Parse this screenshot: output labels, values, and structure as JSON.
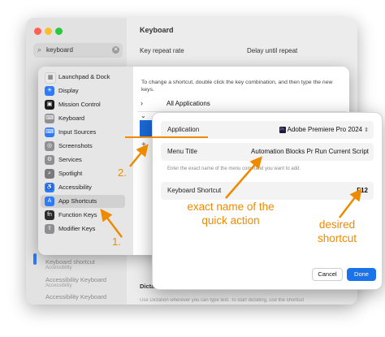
{
  "background_window": {
    "search_text": "keyboard",
    "title": "Keyboard",
    "key_repeat_label": "Key repeat rate",
    "delay_label": "Delay until repeat",
    "sidebar_results": [
      {
        "title": "Keyboard shortcut",
        "sub": "Accessibility"
      },
      {
        "title": "Accessibility Keyboard",
        "sub": "Accessibility"
      },
      {
        "title": "Accessibility Keyboard",
        "sub": ""
      }
    ],
    "dictation_label": "Dicta",
    "dictation_desc": "Use Dictation wherever you can type text. To start dictating, use the shortcut"
  },
  "sheet": {
    "sidebar": [
      {
        "label": "Launchpad & Dock",
        "icon": "launchpad-icon",
        "color": "#e9e9e9",
        "glyph": "▦"
      },
      {
        "label": "Display",
        "icon": "display-icon",
        "color": "#2f7bf5",
        "glyph": "☀"
      },
      {
        "label": "Mission Control",
        "icon": "mission-control-icon",
        "color": "#1c1c1c",
        "glyph": "▣"
      },
      {
        "label": "Keyboard",
        "icon": "keyboard-icon",
        "color": "#8e8e93",
        "glyph": "⌨"
      },
      {
        "label": "Input Sources",
        "icon": "input-sources-icon",
        "color": "#2f7bf5",
        "glyph": "⌨"
      },
      {
        "label": "Screenshots",
        "icon": "screenshots-icon",
        "color": "#8e8e93",
        "glyph": "◎"
      },
      {
        "label": "Services",
        "icon": "services-icon",
        "color": "#8e8e93",
        "glyph": "⚙"
      },
      {
        "label": "Spotlight",
        "icon": "spotlight-icon",
        "color": "#7a7a7e",
        "glyph": "⌕"
      },
      {
        "label": "Accessibility",
        "icon": "accessibility-icon",
        "color": "#2f7bf5",
        "glyph": "♿"
      },
      {
        "label": "App Shortcuts",
        "icon": "app-shortcuts-icon",
        "color": "#2f7bf5",
        "glyph": "A"
      },
      {
        "label": "Function Keys",
        "icon": "function-keys-icon",
        "color": "#2b2b2b",
        "glyph": "fn"
      },
      {
        "label": "Modifier Keys",
        "icon": "modifier-keys-icon",
        "color": "#8e8e93",
        "glyph": "⇧"
      }
    ],
    "selected_index": 9,
    "hint": "To change a shortcut, double click the key combination, and then type the new keys.",
    "all_applications": "All Applications",
    "plus": "+"
  },
  "dialog": {
    "application_label": "Application",
    "application_value": "Adobe Premiere Pro 2024",
    "app_icon_text": "Pr",
    "menu_title_label": "Menu Title",
    "menu_title_value": "Automation Blocks Pr Run Current Script",
    "menu_hint": "Enter the exact name of the menu command you want to add.",
    "keyboard_shortcut_label": "Keyboard Shortcut",
    "keyboard_shortcut_value": "F12",
    "cancel": "Cancel",
    "done": "Done"
  },
  "annotations": {
    "exact_line1": "exact name of the",
    "exact_line2": "quick action",
    "desired_line1": "desired",
    "desired_line2": "shortcut",
    "step1": "1.",
    "step2": "2.",
    "accent": "#ee8a00"
  }
}
